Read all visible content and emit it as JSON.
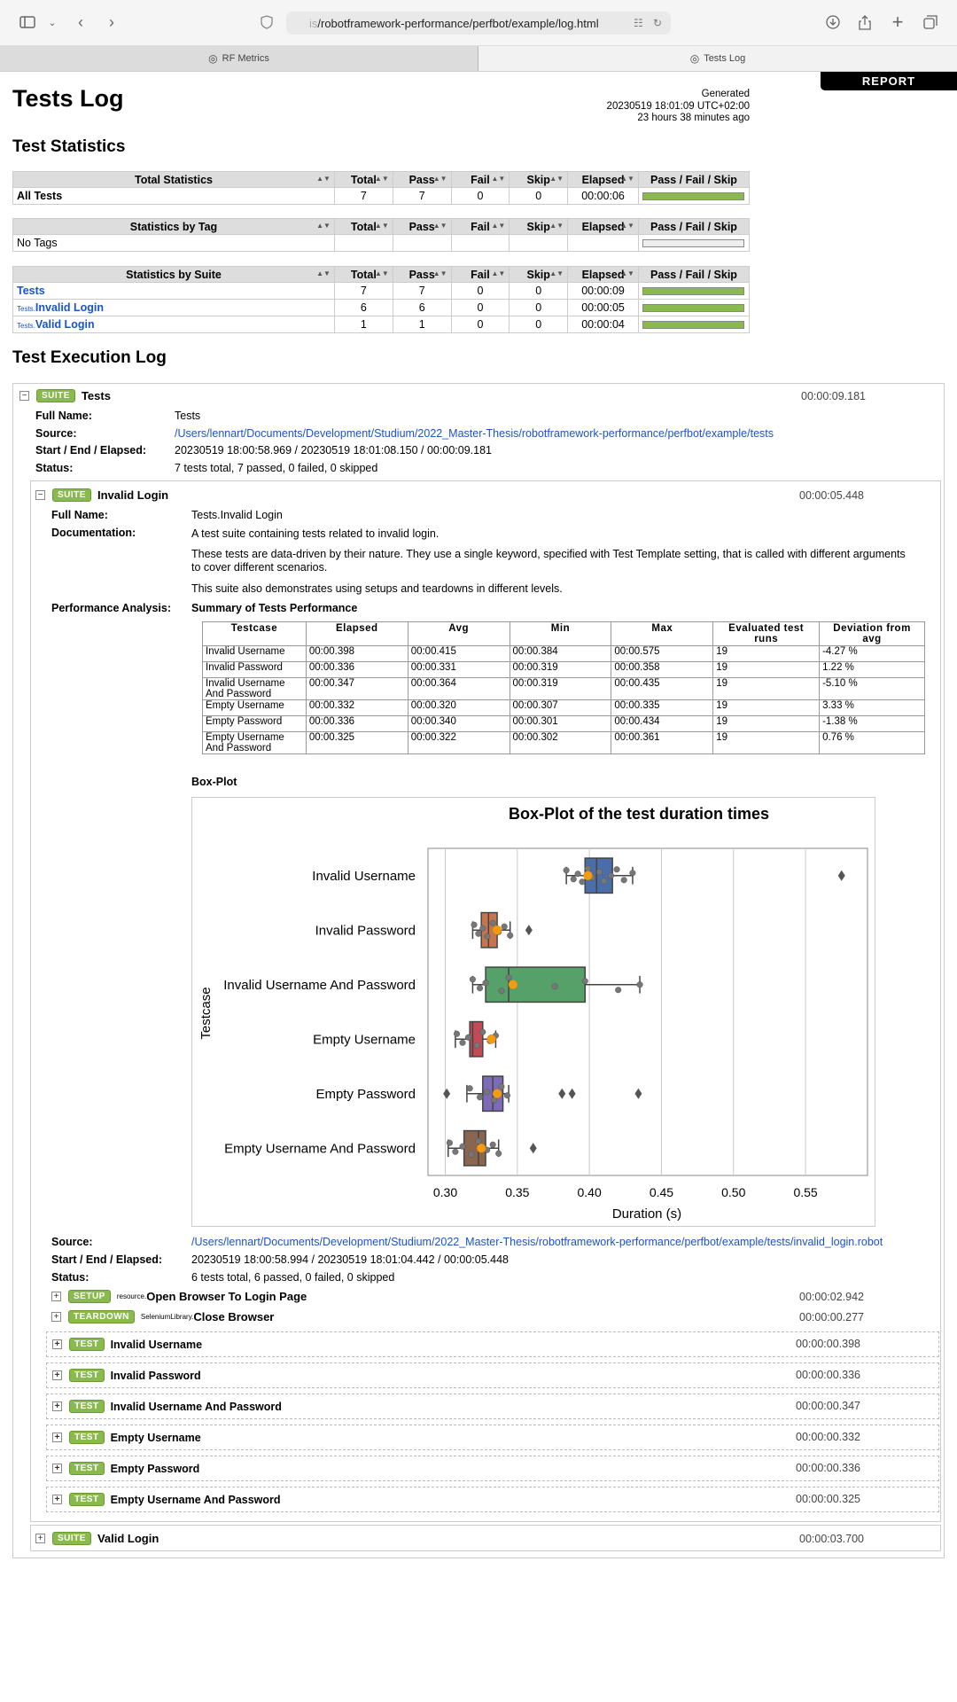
{
  "browser": {
    "url_prefix": "is",
    "url_main": "/robotframework-performance/perfbot/example/log.html"
  },
  "tabs": [
    {
      "label": "RF Metrics"
    },
    {
      "label": "Tests Log"
    }
  ],
  "report_button": "REPORT",
  "page_title": "Tests Log",
  "generated": {
    "label": "Generated",
    "timestamp": "20230519 18:01:09 UTC+02:00",
    "ago": "23 hours 38 minutes ago"
  },
  "stats_title": "Test Statistics",
  "stats_headers": {
    "total": "Total",
    "pass": "Pass",
    "fail": "Fail",
    "skip": "Skip",
    "elapsed": "Elapsed",
    "pfs": "Pass / Fail / Skip"
  },
  "total_stats": {
    "header": "Total Statistics",
    "rows": [
      {
        "name": "All Tests",
        "total": "7",
        "pass": "7",
        "fail": "0",
        "skip": "0",
        "elapsed": "00:00:06",
        "pass_fraction": 1
      }
    ]
  },
  "tag_stats": {
    "header": "Statistics by Tag",
    "rows": [
      {
        "name": "No Tags"
      }
    ]
  },
  "suite_stats": {
    "header": "Statistics by Suite",
    "rows": [
      {
        "prefix": "",
        "name": "Tests",
        "total": "7",
        "pass": "7",
        "fail": "0",
        "skip": "0",
        "elapsed": "00:00:09",
        "pass_fraction": 1
      },
      {
        "prefix": "Tests.",
        "name": "Invalid Login",
        "total": "6",
        "pass": "6",
        "fail": "0",
        "skip": "0",
        "elapsed": "00:00:05",
        "pass_fraction": 1
      },
      {
        "prefix": "Tests.",
        "name": "Valid Login",
        "total": "1",
        "pass": "1",
        "fail": "0",
        "skip": "0",
        "elapsed": "00:00:04",
        "pass_fraction": 1
      }
    ]
  },
  "exec_title": "Test Execution Log",
  "suite_label": "SUITE",
  "top_suite": {
    "name": "Tests",
    "elapsed": "00:00:09.181",
    "full_name_label": "Full Name:",
    "full_name": "Tests",
    "source_label": "Source:",
    "source": "/Users/lennart/Documents/Development/Studium/2022_Master-Thesis/robotframework-performance/perfbot/example/tests",
    "times_label": "Start / End / Elapsed:",
    "times": "20230519 18:00:58.969 / 20230519 18:01:08.150 / 00:00:09.181",
    "status_label": "Status:",
    "status": "7 tests total, 7 passed, 0 failed, 0 skipped"
  },
  "invalid_suite": {
    "name": "Invalid Login",
    "elapsed": "00:00:05.448",
    "full_name_label": "Full Name:",
    "full_name": "Tests.Invalid Login",
    "doc_label": "Documentation:",
    "doc1": "A test suite containing tests related to invalid login.",
    "doc2a": "These tests are data-driven by their nature. They use a single keyword, specified with Test Template setting, that is called with different arguments",
    "doc2b": "to cover different scenarios.",
    "doc3": "This suite also demonstrates using setups and teardowns in different levels.",
    "perf_label": "Performance Analysis:",
    "perf_title": "Summary of Tests Performance",
    "boxplot_label": "Box-Plot",
    "source_label": "Source:",
    "source": "/Users/lennart/Documents/Development/Studium/2022_Master-Thesis/robotframework-performance/perfbot/example/tests/invalid_login.robot",
    "times_label": "Start / End / Elapsed:",
    "times": "20230519 18:00:58.994 / 20230519 18:01:04.442 / 00:00:05.448",
    "status_label": "Status:",
    "status": "6 tests total, 6 passed, 0 failed, 0 skipped",
    "setup": {
      "badge": "SETUP",
      "prefix": "resource.",
      "name": "Open Browser To Login Page",
      "elapsed": "00:00:02.942"
    },
    "teardown": {
      "badge": "TEARDOWN",
      "prefix": "SeleniumLibrary.",
      "name": "Close Browser",
      "elapsed": "00:00:00.277"
    },
    "test_badge": "TEST",
    "tests": [
      {
        "name": "Invalid Username",
        "elapsed": "00:00:00.398"
      },
      {
        "name": "Invalid Password",
        "elapsed": "00:00:00.336"
      },
      {
        "name": "Invalid Username And Password",
        "elapsed": "00:00:00.347"
      },
      {
        "name": "Empty Username",
        "elapsed": "00:00:00.332"
      },
      {
        "name": "Empty Password",
        "elapsed": "00:00:00.336"
      },
      {
        "name": "Empty Username And Password",
        "elapsed": "00:00:00.325"
      }
    ]
  },
  "perf_table": {
    "headers": [
      "Testcase",
      "Elapsed",
      "Avg",
      "Min",
      "Max",
      "Evaluated test runs",
      "Deviation from avg"
    ],
    "rows": [
      [
        "Invalid Username",
        "00:00.398",
        "00:00.415",
        "00:00.384",
        "00:00.575",
        "19",
        "-4.27 %"
      ],
      [
        "Invalid Password",
        "00:00.336",
        "00:00.331",
        "00:00.319",
        "00:00.358",
        "19",
        "1.22 %"
      ],
      [
        "Invalid Username And Password",
        "00:00.347",
        "00:00.364",
        "00:00.319",
        "00:00.435",
        "19",
        "-5.10 %"
      ],
      [
        "Empty Username",
        "00:00.332",
        "00:00.320",
        "00:00.307",
        "00:00.335",
        "19",
        "3.33 %"
      ],
      [
        "Empty Password",
        "00:00.336",
        "00:00.340",
        "00:00.301",
        "00:00.434",
        "19",
        "-1.38 %"
      ],
      [
        "Empty Username And Password",
        "00:00.325",
        "00:00.322",
        "00:00.302",
        "00:00.361",
        "19",
        "0.76 %"
      ]
    ]
  },
  "valid_suite": {
    "name": "Valid Login",
    "elapsed": "00:00:03.700"
  },
  "chart_data": {
    "type": "box",
    "title": "Box-Plot of the test duration times",
    "xlabel": "Duration (s)",
    "ylabel": "Testcase",
    "xlim": [
      0.288,
      0.593
    ],
    "xticks": [
      0.3,
      0.35,
      0.4,
      0.45,
      0.5,
      0.55
    ],
    "xtick_labels": [
      "0.30",
      "0.35",
      "0.40",
      "0.45",
      "0.50",
      "0.55"
    ],
    "grid": true,
    "series": [
      {
        "name": "Invalid Username",
        "color": "#4c6ea8",
        "whisker_low": 0.384,
        "q1": 0.397,
        "median": 0.405,
        "q3": 0.416,
        "whisker_high": 0.43,
        "mean": 0.399,
        "outliers": [
          0.575
        ],
        "points": [
          0.384,
          0.389,
          0.392,
          0.395,
          0.399,
          0.402,
          0.407,
          0.41,
          0.415,
          0.419,
          0.424,
          0.43
        ]
      },
      {
        "name": "Invalid Password",
        "color": "#c8754d",
        "whisker_low": 0.319,
        "q1": 0.325,
        "median": 0.33,
        "q3": 0.336,
        "whisker_high": 0.345,
        "mean": 0.336,
        "outliers": [
          0.358
        ],
        "points": [
          0.32,
          0.323,
          0.326,
          0.329,
          0.333,
          0.337,
          0.341,
          0.345
        ]
      },
      {
        "name": "Invalid Username And Password",
        "color": "#56a06a",
        "whisker_low": 0.319,
        "q1": 0.328,
        "median": 0.344,
        "q3": 0.397,
        "whisker_high": 0.435,
        "mean": 0.347,
        "outliers": [],
        "points": [
          0.319,
          0.324,
          0.328,
          0.339,
          0.344,
          0.376,
          0.397,
          0.42,
          0.435
        ]
      },
      {
        "name": "Empty Username",
        "color": "#c24b55",
        "whisker_low": 0.307,
        "q1": 0.317,
        "median": 0.319,
        "q3": 0.326,
        "whisker_high": 0.335,
        "mean": 0.332,
        "outliers": [],
        "points": [
          0.308,
          0.312,
          0.316,
          0.322,
          0.326,
          0.331,
          0.335
        ]
      },
      {
        "name": "Empty Password",
        "color": "#7d6bb5",
        "whisker_low": 0.315,
        "q1": 0.326,
        "median": 0.333,
        "q3": 0.34,
        "whisker_high": 0.344,
        "mean": 0.336,
        "outliers": [
          0.301,
          0.381,
          0.388,
          0.434
        ],
        "points": [
          0.317,
          0.324,
          0.329,
          0.334,
          0.339,
          0.343
        ]
      },
      {
        "name": "Empty Username And Password",
        "color": "#8a6650",
        "whisker_low": 0.302,
        "q1": 0.313,
        "median": 0.323,
        "q3": 0.328,
        "whisker_high": 0.337,
        "mean": 0.325,
        "outliers": [
          0.361
        ],
        "points": [
          0.303,
          0.307,
          0.312,
          0.318,
          0.323,
          0.329,
          0.333,
          0.337
        ]
      }
    ]
  }
}
